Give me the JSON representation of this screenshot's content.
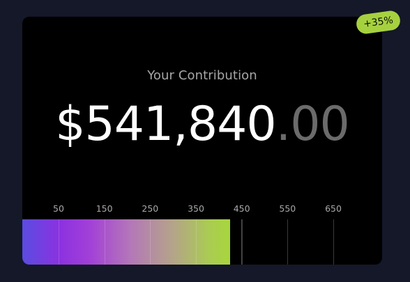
{
  "card": {
    "title": "Your Contribution",
    "amount_main": "$541,840",
    "amount_cents": ".00"
  },
  "badge": {
    "label": "+35%"
  },
  "scale": {
    "ticks": [
      "50",
      "150",
      "250",
      "350",
      "450",
      "550",
      "650"
    ],
    "filled_value": 425
  },
  "colors": {
    "background": "#141828",
    "card": "#000000",
    "badge": "#a6d13f",
    "gradient_start": "#5a4ce0",
    "gradient_end": "#a8d63c"
  }
}
